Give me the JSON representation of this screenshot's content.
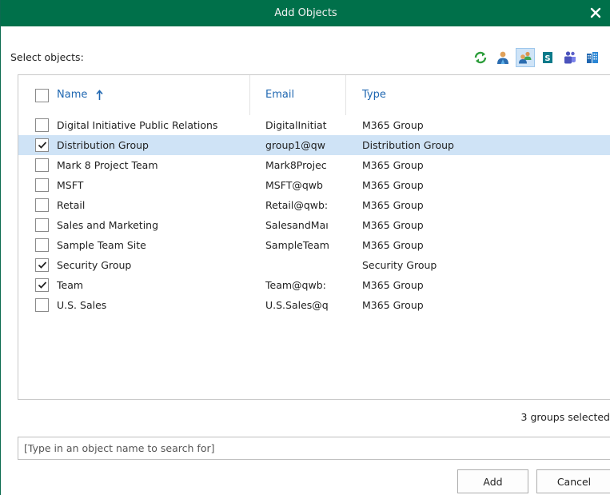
{
  "dialog": {
    "title": "Add Objects",
    "select_label": "Select objects:",
    "toolbar": [
      {
        "icon": "refresh-icon",
        "active": false
      },
      {
        "icon": "user-icon",
        "active": false
      },
      {
        "icon": "group-icon",
        "active": true
      },
      {
        "icon": "sharepoint-site-icon",
        "active": false
      },
      {
        "icon": "teams-icon",
        "active": false
      },
      {
        "icon": "organization-icon",
        "active": false
      }
    ]
  },
  "table": {
    "columns": {
      "name": "Name",
      "email": "Email",
      "type": "Type",
      "sort": "ascending"
    },
    "rows": [
      {
        "checked": false,
        "selected": false,
        "name": "Digital Initiative Public Relations",
        "email": "DigitalInitiat",
        "type": "M365 Group"
      },
      {
        "checked": true,
        "selected": true,
        "name": "Distribution Group",
        "email": "group1@qw",
        "type": "Distribution Group"
      },
      {
        "checked": false,
        "selected": false,
        "name": "Mark 8 Project Team",
        "email": "Mark8Projec",
        "type": "M365 Group"
      },
      {
        "checked": false,
        "selected": false,
        "name": "MSFT",
        "email": "MSFT@qwb",
        "type": "M365 Group"
      },
      {
        "checked": false,
        "selected": false,
        "name": "Retail",
        "email": "Retail@qwb:",
        "type": "M365 Group"
      },
      {
        "checked": false,
        "selected": false,
        "name": "Sales and Marketing",
        "email": "SalesandMaı",
        "type": "M365 Group"
      },
      {
        "checked": false,
        "selected": false,
        "name": "Sample Team Site",
        "email": "SampleTeam",
        "type": "M365 Group"
      },
      {
        "checked": true,
        "selected": false,
        "name": "Security Group",
        "email": "",
        "type": "Security Group"
      },
      {
        "checked": true,
        "selected": false,
        "name": "Team",
        "email": "Team@qwb:",
        "type": "M365 Group"
      },
      {
        "checked": false,
        "selected": false,
        "name": "U.S. Sales",
        "email": "U.S.Sales@q",
        "type": "M365 Group"
      }
    ]
  },
  "status": "3 groups selected",
  "search": {
    "placeholder": "[Type in an object name to search for]",
    "value": ""
  },
  "buttons": {
    "add": "Add",
    "cancel": "Cancel"
  },
  "colors": {
    "titlebar": "#00704a",
    "header_text": "#1f67b1",
    "selected_row": "#cfe3f6",
    "active_toolbar": "#cfe4f7"
  }
}
